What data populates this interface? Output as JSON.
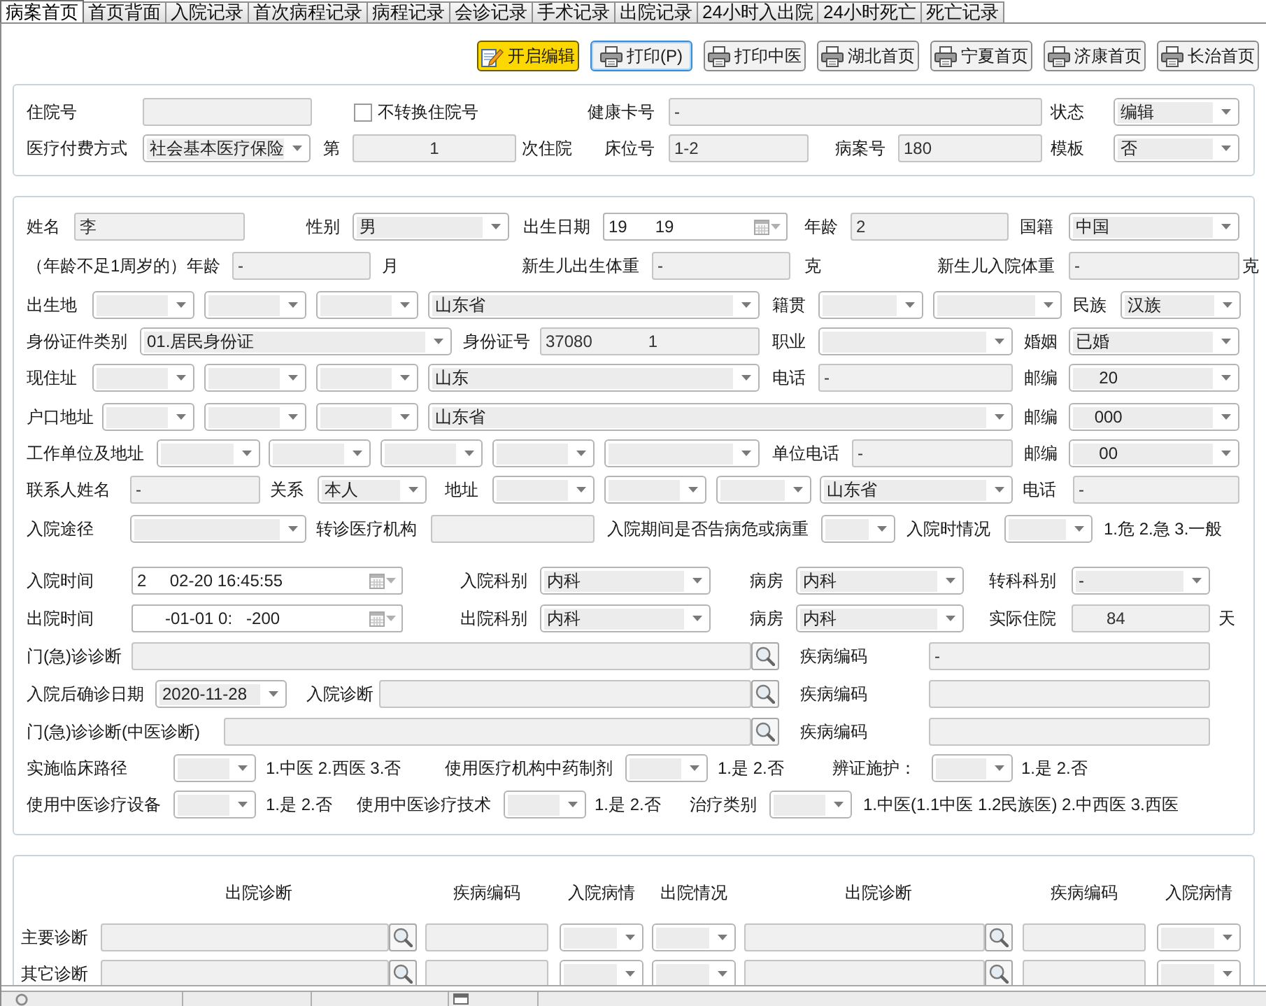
{
  "tabs": [
    {
      "label": "病案首页",
      "selected": true
    },
    {
      "label": "首页背面",
      "selected": false
    },
    {
      "label": "入院记录",
      "selected": false
    },
    {
      "label": "首次病程记录",
      "selected": false
    },
    {
      "label": "病程记录",
      "selected": false
    },
    {
      "label": "会诊记录",
      "selected": false
    },
    {
      "label": "手术记录",
      "selected": false
    },
    {
      "label": "出院记录",
      "selected": false
    },
    {
      "label": "24小时入出院",
      "selected": false
    },
    {
      "label": "24小时死亡",
      "selected": false
    },
    {
      "label": "死亡记录",
      "selected": false
    }
  ],
  "toolbar": [
    {
      "kind": "edit",
      "label": "开启编辑",
      "focused": false
    },
    {
      "kind": "print",
      "label": "打印(P)",
      "focused": true
    },
    {
      "kind": "print",
      "label": "打印中医",
      "focused": false
    },
    {
      "kind": "print",
      "label": "湖北首页",
      "focused": false
    },
    {
      "kind": "print",
      "label": "宁夏首页",
      "focused": false
    },
    {
      "kind": "print",
      "label": "济康首页",
      "focused": false
    },
    {
      "kind": "print",
      "label": "长治首页",
      "focused": false
    }
  ],
  "header_section": {
    "rows": [
      {
        "items": [
          {
            "kind": "label",
            "text": "住院号"
          },
          {
            "kind": "text"
          },
          {
            "kind": "checkbox",
            "label": "不转换住院号",
            "checked": false
          },
          {
            "kind": "label",
            "text": "健康卡号"
          },
          {
            "kind": "text",
            "value": "-"
          },
          {
            "kind": "label",
            "text": "状态"
          },
          {
            "kind": "select",
            "value": "编辑"
          }
        ]
      },
      {
        "items": [
          {
            "kind": "label",
            "text": "医疗付费方式"
          },
          {
            "kind": "select",
            "value": "社会基本医疗保险"
          },
          {
            "kind": "label",
            "text": "第"
          },
          {
            "kind": "text",
            "value": "1"
          },
          {
            "kind": "label",
            "text": "次住院"
          },
          {
            "kind": "label",
            "text": "床位号"
          },
          {
            "kind": "text",
            "value": "1-2"
          },
          {
            "kind": "label",
            "text": "病案号"
          },
          {
            "kind": "text",
            "value": "180"
          },
          {
            "kind": "label",
            "text": "模板"
          },
          {
            "kind": "select",
            "value": "否"
          }
        ]
      }
    ]
  },
  "patient_section": {
    "rows": [
      {
        "items": [
          {
            "kind": "label",
            "text": "姓名"
          },
          {
            "kind": "text",
            "value": "李"
          },
          {
            "kind": "label",
            "text": "性别"
          },
          {
            "kind": "select",
            "value": "男"
          },
          {
            "kind": "label",
            "text": "出生日期"
          },
          {
            "kind": "date",
            "value": "19      19"
          },
          {
            "kind": "label",
            "text": "年龄"
          },
          {
            "kind": "text",
            "value": "2"
          },
          {
            "kind": "label",
            "text": "国籍"
          },
          {
            "kind": "select",
            "value": "中国"
          }
        ]
      },
      {
        "items": [
          {
            "kind": "label",
            "text": "（年龄不足1周岁的）年龄"
          },
          {
            "kind": "text",
            "value": "-"
          },
          {
            "kind": "label",
            "text": "月"
          },
          {
            "kind": "label",
            "text": "新生儿出生体重"
          },
          {
            "kind": "text",
            "value": "-"
          },
          {
            "kind": "label",
            "text": "克"
          },
          {
            "kind": "label",
            "text": "新生儿入院体重"
          },
          {
            "kind": "text",
            "value": "-"
          },
          {
            "kind": "label",
            "text": "克"
          }
        ]
      },
      {
        "items": [
          {
            "kind": "label",
            "text": "出生地"
          },
          {
            "kind": "select"
          },
          {
            "kind": "select"
          },
          {
            "kind": "select"
          },
          {
            "kind": "select",
            "value": "山东省"
          },
          {
            "kind": "label",
            "text": "籍贯"
          },
          {
            "kind": "select"
          },
          {
            "kind": "select"
          },
          {
            "kind": "label",
            "text": "民族"
          },
          {
            "kind": "select",
            "value": "汉族"
          }
        ]
      },
      {
        "items": [
          {
            "kind": "label",
            "text": "身份证件类别"
          },
          {
            "kind": "select",
            "value": "01.居民身份证"
          },
          {
            "kind": "label",
            "text": "身份证号"
          },
          {
            "kind": "text",
            "value": "37080            1"
          },
          {
            "kind": "label",
            "text": "职业"
          },
          {
            "kind": "select"
          },
          {
            "kind": "label",
            "text": "婚姻"
          },
          {
            "kind": "select",
            "value": "已婚"
          }
        ]
      },
      {
        "items": [
          {
            "kind": "label",
            "text": "现住址"
          },
          {
            "kind": "select"
          },
          {
            "kind": "select"
          },
          {
            "kind": "select"
          },
          {
            "kind": "select",
            "value": "山东"
          },
          {
            "kind": "label",
            "text": "电话"
          },
          {
            "kind": "text",
            "value": "-"
          },
          {
            "kind": "label",
            "text": "邮编"
          },
          {
            "kind": "select",
            "value": "     20"
          }
        ]
      },
      {
        "items": [
          {
            "kind": "label",
            "text": "户口地址"
          },
          {
            "kind": "select"
          },
          {
            "kind": "select"
          },
          {
            "kind": "select"
          },
          {
            "kind": "select",
            "value": "山东省"
          },
          {
            "kind": "label",
            "text": "邮编"
          },
          {
            "kind": "select",
            "value": "    000"
          }
        ]
      },
      {
        "items": [
          {
            "kind": "label",
            "text": "工作单位及地址"
          },
          {
            "kind": "select"
          },
          {
            "kind": "select"
          },
          {
            "kind": "select"
          },
          {
            "kind": "select"
          },
          {
            "kind": "select"
          },
          {
            "kind": "label",
            "text": "单位电话"
          },
          {
            "kind": "text",
            "value": "-"
          },
          {
            "kind": "label",
            "text": "邮编"
          },
          {
            "kind": "select",
            "value": "     00"
          }
        ]
      },
      {
        "items": [
          {
            "kind": "label",
            "text": "联系人姓名"
          },
          {
            "kind": "text",
            "value": "-"
          },
          {
            "kind": "label",
            "text": "关系"
          },
          {
            "kind": "select",
            "value": "本人"
          },
          {
            "kind": "label",
            "text": "地址"
          },
          {
            "kind": "select"
          },
          {
            "kind": "select"
          },
          {
            "kind": "select"
          },
          {
            "kind": "select",
            "value": "山东省"
          },
          {
            "kind": "label",
            "text": "电话"
          },
          {
            "kind": "text",
            "value": "-"
          }
        ]
      },
      {
        "items": [
          {
            "kind": "label",
            "text": "入院途径"
          },
          {
            "kind": "select"
          },
          {
            "kind": "label",
            "text": "转诊医疗机构"
          },
          {
            "kind": "text"
          },
          {
            "kind": "label",
            "text": "入院期间是否告病危或病重"
          },
          {
            "kind": "select"
          },
          {
            "kind": "label",
            "text": "入院时情况"
          },
          {
            "kind": "select"
          },
          {
            "kind": "note",
            "text": "1.危 2.急 3.一般"
          }
        ]
      },
      {
        "items": [
          {
            "kind": "label",
            "text": "入院时间"
          },
          {
            "kind": "date",
            "value": "2     02-20 16:45:55"
          },
          {
            "kind": "label",
            "text": "入院科别"
          },
          {
            "kind": "select",
            "value": "内科"
          },
          {
            "kind": "label",
            "text": "病房"
          },
          {
            "kind": "select",
            "value": "内科"
          },
          {
            "kind": "label",
            "text": "转科科别"
          },
          {
            "kind": "select",
            "value": "-"
          }
        ]
      },
      {
        "items": [
          {
            "kind": "label",
            "text": "出院时间"
          },
          {
            "kind": "date",
            "value": "      -01-01 0:   -200"
          },
          {
            "kind": "label",
            "text": "出院科别"
          },
          {
            "kind": "select",
            "value": "内科"
          },
          {
            "kind": "label",
            "text": "病房"
          },
          {
            "kind": "select",
            "value": "内科"
          },
          {
            "kind": "label",
            "text": "实际住院"
          },
          {
            "kind": "text",
            "value": "84"
          },
          {
            "kind": "label",
            "text": "天"
          }
        ]
      },
      {
        "items": [
          {
            "kind": "label",
            "text": "门(急)诊诊断"
          },
          {
            "kind": "search"
          },
          {
            "kind": "label",
            "text": "疾病编码"
          },
          {
            "kind": "text",
            "value": "-"
          }
        ]
      },
      {
        "items": [
          {
            "kind": "label",
            "text": "入院后确诊日期"
          },
          {
            "kind": "select",
            "value": "2020-11-28"
          },
          {
            "kind": "label",
            "text": "入院诊断"
          },
          {
            "kind": "search"
          },
          {
            "kind": "label",
            "text": "疾病编码"
          },
          {
            "kind": "text"
          }
        ]
      },
      {
        "items": [
          {
            "kind": "label",
            "text": "门(急)诊诊断(中医诊断)"
          },
          {
            "kind": "search"
          },
          {
            "kind": "label",
            "text": "疾病编码"
          },
          {
            "kind": "text"
          }
        ]
      },
      {
        "items": [
          {
            "kind": "label",
            "text": "实施临床路径"
          },
          {
            "kind": "select"
          },
          {
            "kind": "note",
            "text": "1.中医 2.西医 3.否"
          },
          {
            "kind": "label",
            "text": "使用医疗机构中药制剂"
          },
          {
            "kind": "select"
          },
          {
            "kind": "note",
            "text": "1.是 2.否"
          },
          {
            "kind": "label",
            "text": "辨证施护："
          },
          {
            "kind": "select"
          },
          {
            "kind": "note",
            "text": "1.是 2.否"
          }
        ]
      },
      {
        "items": [
          {
            "kind": "label",
            "text": "使用中医诊疗设备"
          },
          {
            "kind": "select"
          },
          {
            "kind": "note",
            "text": "1.是 2.否"
          },
          {
            "kind": "label",
            "text": "使用中医诊疗技术"
          },
          {
            "kind": "select"
          },
          {
            "kind": "note",
            "text": "1.是 2.否"
          },
          {
            "kind": "label",
            "text": "治疗类别"
          },
          {
            "kind": "select"
          },
          {
            "kind": "note",
            "text": "1.中医(1.1中医 1.2民族医) 2.中西医 3.西医"
          }
        ]
      }
    ]
  },
  "diagnosis_section": {
    "columns": [
      "出院诊断",
      "疾病编码",
      "入院病情",
      "出院情况",
      "出院诊断",
      "疾病编码",
      "入院病情"
    ],
    "rows": [
      {
        "label": "主要诊断",
        "cells": [
          {
            "kind": "search"
          },
          {
            "kind": "text"
          },
          {
            "kind": "select"
          },
          {
            "kind": "select"
          },
          {
            "kind": "search"
          },
          {
            "kind": "text"
          },
          {
            "kind": "select"
          }
        ]
      },
      {
        "label": "其它诊断",
        "cells": [
          {
            "kind": "search"
          },
          {
            "kind": "text"
          },
          {
            "kind": "select"
          },
          {
            "kind": "select"
          },
          {
            "kind": "search"
          },
          {
            "kind": "text"
          },
          {
            "kind": "select"
          }
        ]
      }
    ]
  }
}
